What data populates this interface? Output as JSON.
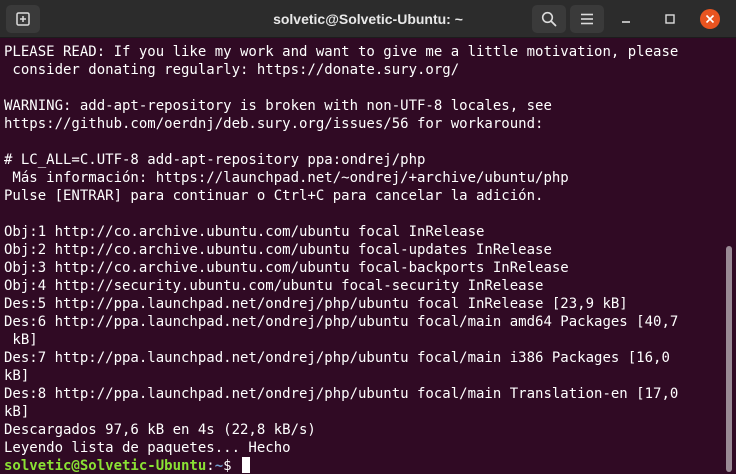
{
  "window": {
    "title": "solvetic@Solvetic-Ubuntu: ~"
  },
  "colors": {
    "terminal_bg": "#300a24",
    "header_bg": "#2c2c2c",
    "close_button": "#e95420",
    "prompt_user": "#8ae234",
    "prompt_path": "#729fcf"
  },
  "icons": {
    "new_tab": "new-tab-icon",
    "search": "search-icon",
    "menu": "hamburger-menu-icon",
    "minimize": "minimize-icon",
    "maximize": "maximize-icon",
    "close": "close-icon"
  },
  "terminal": {
    "lines": [
      "PLEASE READ: If you like my work and want to give me a little motivation, please",
      " consider donating regularly: https://donate.sury.org/",
      "",
      "WARNING: add-apt-repository is broken with non-UTF-8 locales, see",
      "https://github.com/oerdnj/deb.sury.org/issues/56 for workaround:",
      "",
      "# LC_ALL=C.UTF-8 add-apt-repository ppa:ondrej/php",
      " Más información: https://launchpad.net/~ondrej/+archive/ubuntu/php",
      "Pulse [ENTRAR] para continuar o Ctrl+C para cancelar la adición.",
      "",
      "Obj:1 http://co.archive.ubuntu.com/ubuntu focal InRelease",
      "Obj:2 http://co.archive.ubuntu.com/ubuntu focal-updates InRelease",
      "Obj:3 http://co.archive.ubuntu.com/ubuntu focal-backports InRelease",
      "Obj:4 http://security.ubuntu.com/ubuntu focal-security InRelease",
      "Des:5 http://ppa.launchpad.net/ondrej/php/ubuntu focal InRelease [23,9 kB]",
      "Des:6 http://ppa.launchpad.net/ondrej/php/ubuntu focal/main amd64 Packages [40,7",
      " kB]",
      "Des:7 http://ppa.launchpad.net/ondrej/php/ubuntu focal/main i386 Packages [16,0",
      "kB]",
      "Des:8 http://ppa.launchpad.net/ondrej/php/ubuntu focal/main Translation-en [17,0",
      "kB]",
      "Descargados 97,6 kB en 4s (22,8 kB/s)",
      "Leyendo lista de paquetes... Hecho"
    ],
    "prompt": {
      "user_host": "solvetic@Solvetic-Ubuntu",
      "separator": ":",
      "path": "~",
      "symbol": "$"
    }
  }
}
